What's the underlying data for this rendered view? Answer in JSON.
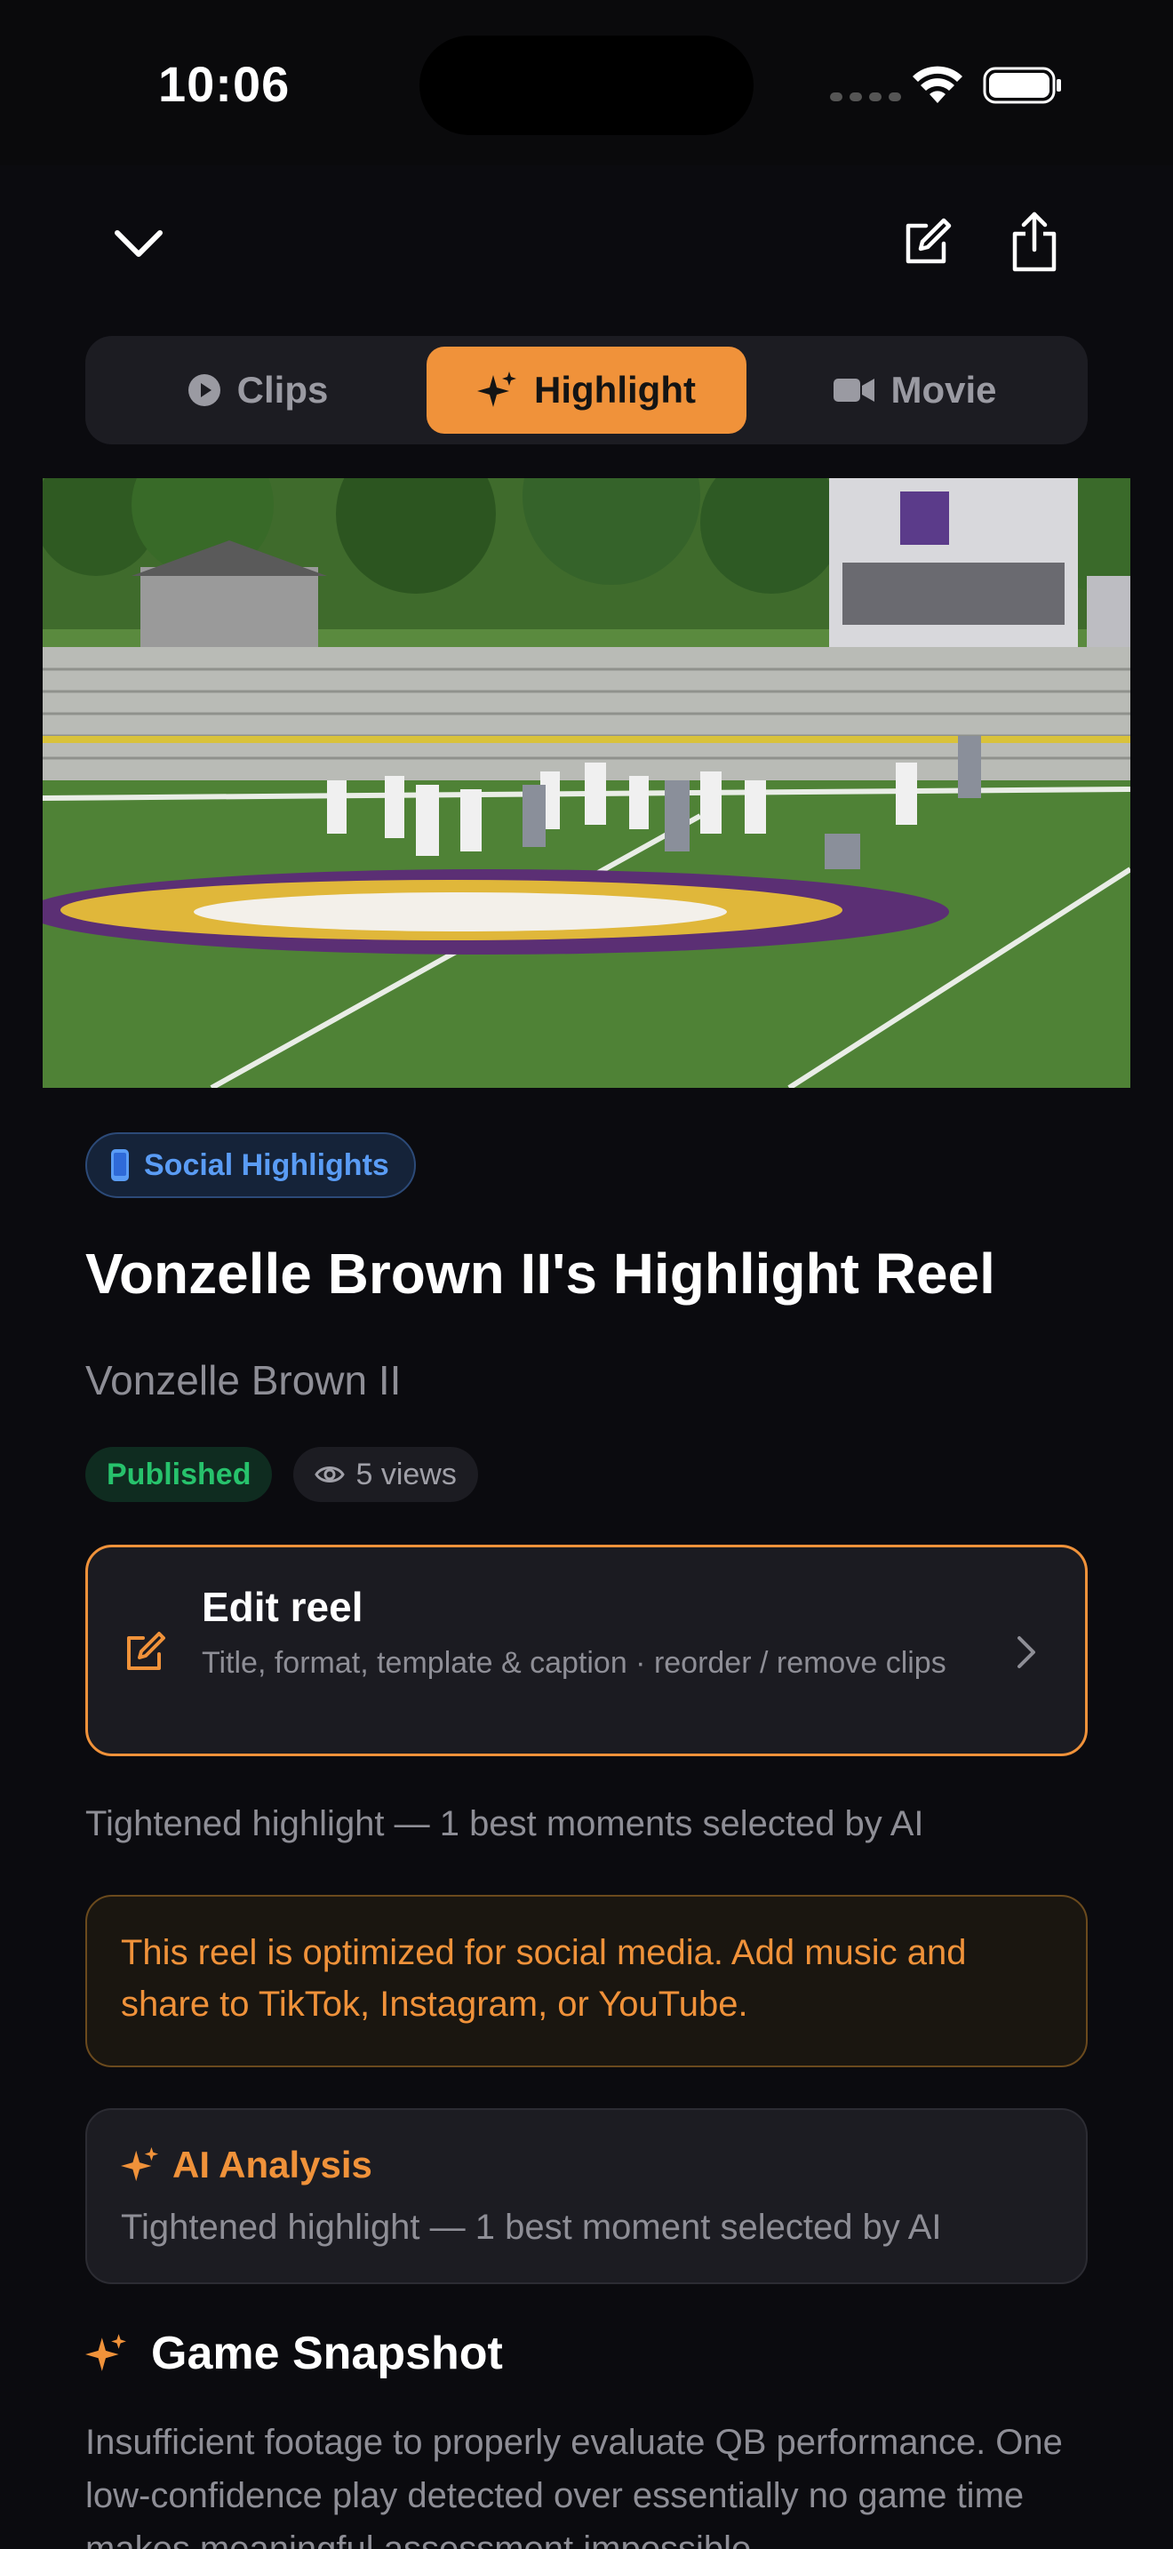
{
  "status_bar": {
    "time": "10:06"
  },
  "nav": {
    "collapse_icon": "chevron-down-icon",
    "edit_icon": "edit-icon",
    "share_icon": "share-icon"
  },
  "tabs": [
    {
      "label": "Clips",
      "icon": "play-circle-icon",
      "active": false
    },
    {
      "label": "Highlight",
      "icon": "sparkles-icon",
      "active": true
    },
    {
      "label": "Movie",
      "icon": "video-camera-icon",
      "active": false
    }
  ],
  "reel": {
    "category": "Social Highlights",
    "title": "Vonzelle Brown II's Highlight Reel",
    "athlete": "Vonzelle Brown II",
    "status": "Published",
    "views": "5 views"
  },
  "edit_card": {
    "title": "Edit reel",
    "description": "Title, format, template & caption · reorder / remove clips"
  },
  "summary_line": "Tightened highlight — 1 best moments selected by AI",
  "social_notice": "This reel is optimized for social media. Add music and share to TikTok, Instagram, or YouTube.",
  "ai_analysis": {
    "heading": "AI Analysis",
    "text": "Tightened highlight — 1 best moment selected by AI"
  },
  "game_snapshot": {
    "heading": "Game Snapshot",
    "text": "Insufficient footage to properly evaluate QB performance. One low-confidence play detected over essentially no game time makes meaningful assessment impossible."
  },
  "colors": {
    "accent": "#f0923a",
    "background": "#0b0b0f",
    "card": "#1c1c22",
    "published": "#27c26c",
    "info_blue": "#5a9cf5"
  }
}
